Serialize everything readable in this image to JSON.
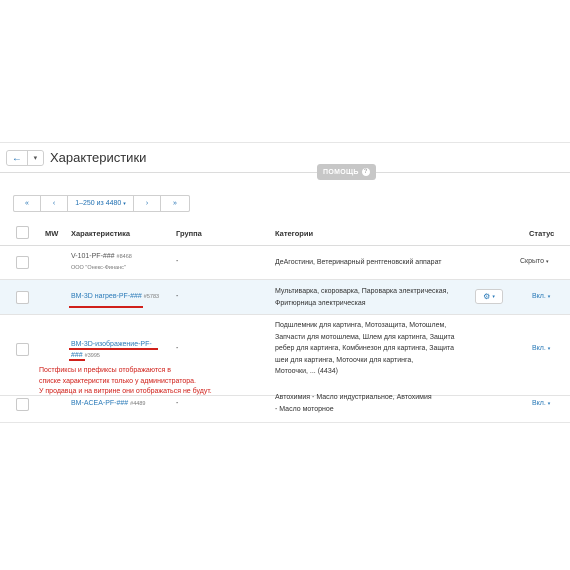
{
  "header": {
    "back_arrow": "←",
    "back_caret": "▾",
    "title": "Характеристики",
    "help_label": "ПОМОЩЬ",
    "help_icon": "?"
  },
  "pager": {
    "first": "«",
    "prev": "‹",
    "range": "1–250 из 4480",
    "range_caret": "▾",
    "next": "›",
    "last": "»"
  },
  "table": {
    "columns": {
      "mw": "MW",
      "feature": "Характеристика",
      "group": "Группа",
      "categories": "Категории",
      "status": "Статус"
    },
    "rows": [
      {
        "name": "V-101-PF-###",
        "code": "#8468",
        "sub": "ООО \"Онекс-Финанс\"",
        "group": "-",
        "categories": [
          "ДеАгостини, Ветеринарный рентгеновский аппарат"
        ],
        "status": "Скрыто",
        "caret": "▾"
      },
      {
        "name": "BM-3D нагрев-PF-###",
        "code": "#5783",
        "group": "-",
        "categories": [
          "Мультиварка, скороварка, Пароварка электрическая,",
          "Фритюрница электрическая"
        ],
        "status": "Вкл.",
        "caret": "▾",
        "gear": "⚙",
        "gear_caret": "▾"
      },
      {
        "name_line1": "BM-3D-изображение-PF-",
        "name_line2": "###",
        "code": "#3995",
        "group": "-",
        "categories": [
          "Подшлемник для картинга, Мотозащита, Мотошлем,",
          "Запчасти для мотошлема, Шлем для картинга, Защита",
          "ребер для картинга, Комбинезон для картинга, Защита",
          "шеи для картинга, Мотоочки для картинга,",
          "Мотоочки, ... (4434)"
        ],
        "status": "Вкл.",
        "caret": "▾"
      },
      {
        "name": "BM-ACEA-PF-###",
        "code": "#4489",
        "group": "-",
        "categories": [
          "Автохимия - Масло индустриальное, Автохимия",
          "- Масло моторное"
        ],
        "status": "Вкл.",
        "caret": "▾"
      }
    ]
  },
  "note": {
    "lines": [
      "Постфиксы и префиксы отображаются в",
      "списке характеристик только у администратора.",
      "У продавца и на витрине они отображаться не будут."
    ]
  },
  "colors": {
    "link": "#2a7ab8",
    "annotation": "#d0201a",
    "highlight_row": "#eef6fb"
  }
}
